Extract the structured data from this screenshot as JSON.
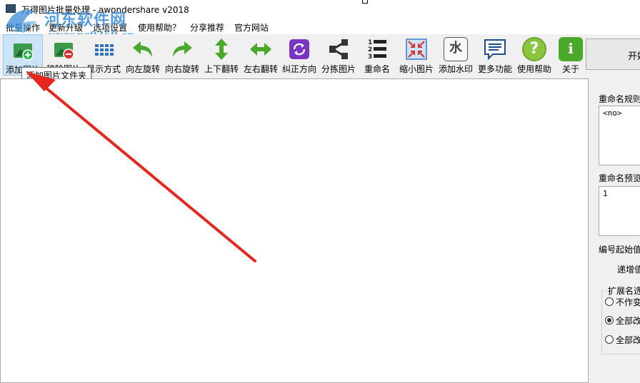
{
  "window": {
    "title": "万得图片批量处理 - awondershare v2018"
  },
  "watermark": {
    "site_name": "河东软件网",
    "url": "www.pc0359.cn"
  },
  "menu": {
    "items": [
      {
        "label": "批量操作"
      },
      {
        "label": "更新升级"
      },
      {
        "label": "选项设置"
      },
      {
        "label": "使用帮助？"
      },
      {
        "label": "分享推荐"
      },
      {
        "label": "官方网站"
      }
    ]
  },
  "toolbar": {
    "items": [
      {
        "label": "添加图片",
        "icon": "add-image-icon"
      },
      {
        "label": "移除图片",
        "icon": "remove-image-icon"
      },
      {
        "label": "显示方式",
        "icon": "grid-view-icon"
      },
      {
        "label": "向左旋转",
        "icon": "rotate-left-icon"
      },
      {
        "label": "向右旋转",
        "icon": "rotate-right-icon"
      },
      {
        "label": "上下翻转",
        "icon": "flip-vertical-icon"
      },
      {
        "label": "左右翻转",
        "icon": "flip-horizontal-icon"
      },
      {
        "label": "纠正方向",
        "icon": "correct-orientation-icon"
      },
      {
        "label": "分拣图片",
        "icon": "sort-images-icon"
      },
      {
        "label": "重命名",
        "icon": "rename-icon"
      },
      {
        "label": "缩小图片",
        "icon": "shrink-image-icon"
      },
      {
        "label": "添加水印",
        "icon": "watermark-icon",
        "glyph": "水"
      },
      {
        "label": "更多功能",
        "icon": "more-features-icon"
      },
      {
        "label": "使用帮助",
        "icon": "help-icon",
        "glyph": "?"
      },
      {
        "label": "关于",
        "icon": "about-icon",
        "glyph": "i"
      }
    ],
    "tooltip": "添加图片文件夹"
  },
  "start_button": {
    "label": "开始"
  },
  "right_panel": {
    "rename_rule_label": "重命名规则",
    "rename_rule_value": "<no>",
    "rename_preview_label": "重命名预览",
    "rename_preview_value": "1",
    "start_number_label": "编号起始值",
    "increment_label": "递增值",
    "extension_group_label": "扩展名选项",
    "ext_options": [
      {
        "label": "不作变",
        "checked": false
      },
      {
        "label": "全部改",
        "checked": true
      },
      {
        "label": "全部改",
        "checked": false
      }
    ]
  },
  "colors": {
    "accent_arrow": "#e8261e",
    "selection": "#cce4f7"
  }
}
